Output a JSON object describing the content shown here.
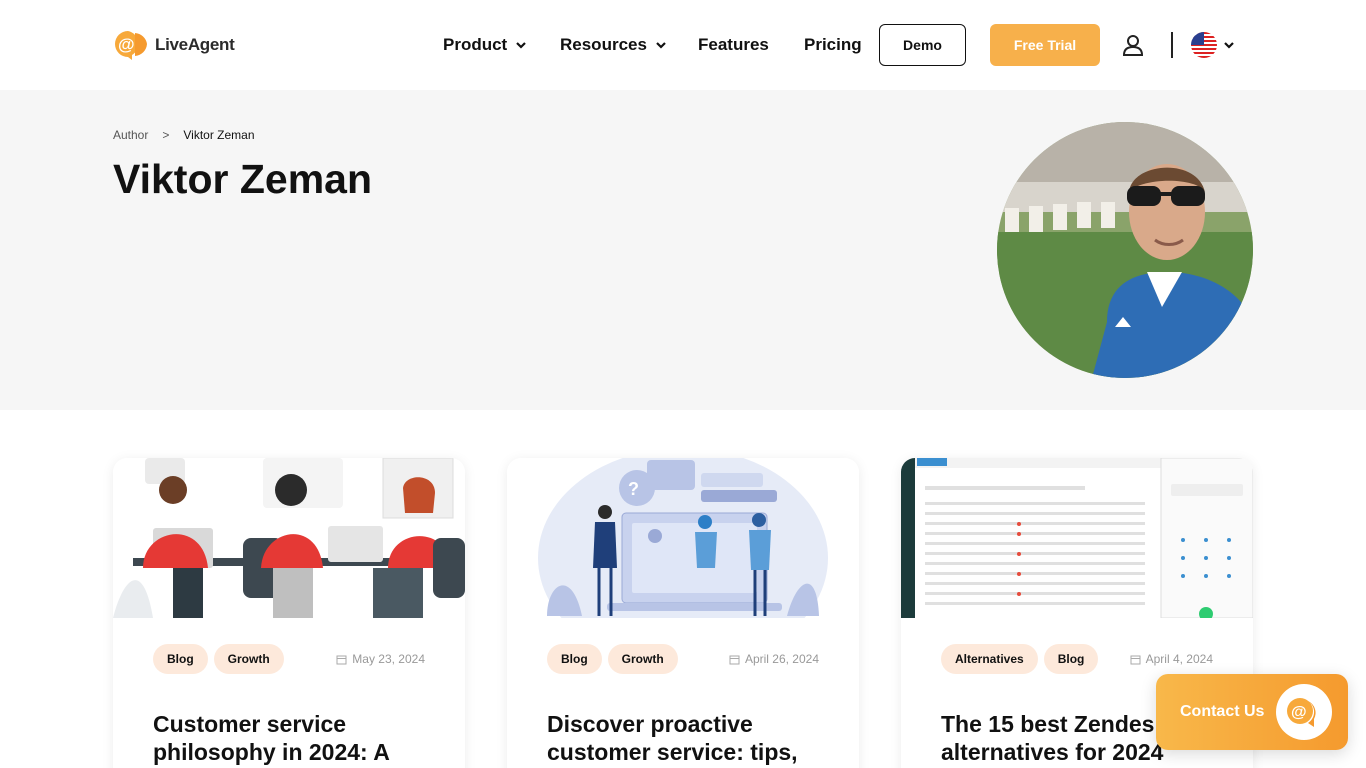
{
  "brand": {
    "name": "LiveAgent",
    "accent": "#f7a93b"
  },
  "nav": {
    "product": "Product",
    "resources": "Resources",
    "features": "Features",
    "pricing": "Pricing",
    "demo": "Demo",
    "free_trial": "Free Trial",
    "language_icon": "us-flag-icon"
  },
  "breadcrumb": {
    "root": "Author",
    "separator": ">",
    "current": "Viktor Zeman"
  },
  "hero": {
    "title": "Viktor Zeman"
  },
  "cards": [
    {
      "tags": [
        "Blog",
        "Growth"
      ],
      "date": "May 23, 2024",
      "title": "Customer service philosophy in 2024: A"
    },
    {
      "tags": [
        "Blog",
        "Growth"
      ],
      "date": "April 26, 2024",
      "title": "Discover proactive customer service: tips,"
    },
    {
      "tags": [
        "Alternatives",
        "Blog"
      ],
      "date": "April 4, 2024",
      "title": "The 15 best Zendesk alternatives for 2024"
    }
  ],
  "contact": {
    "label": "Contact Us"
  }
}
